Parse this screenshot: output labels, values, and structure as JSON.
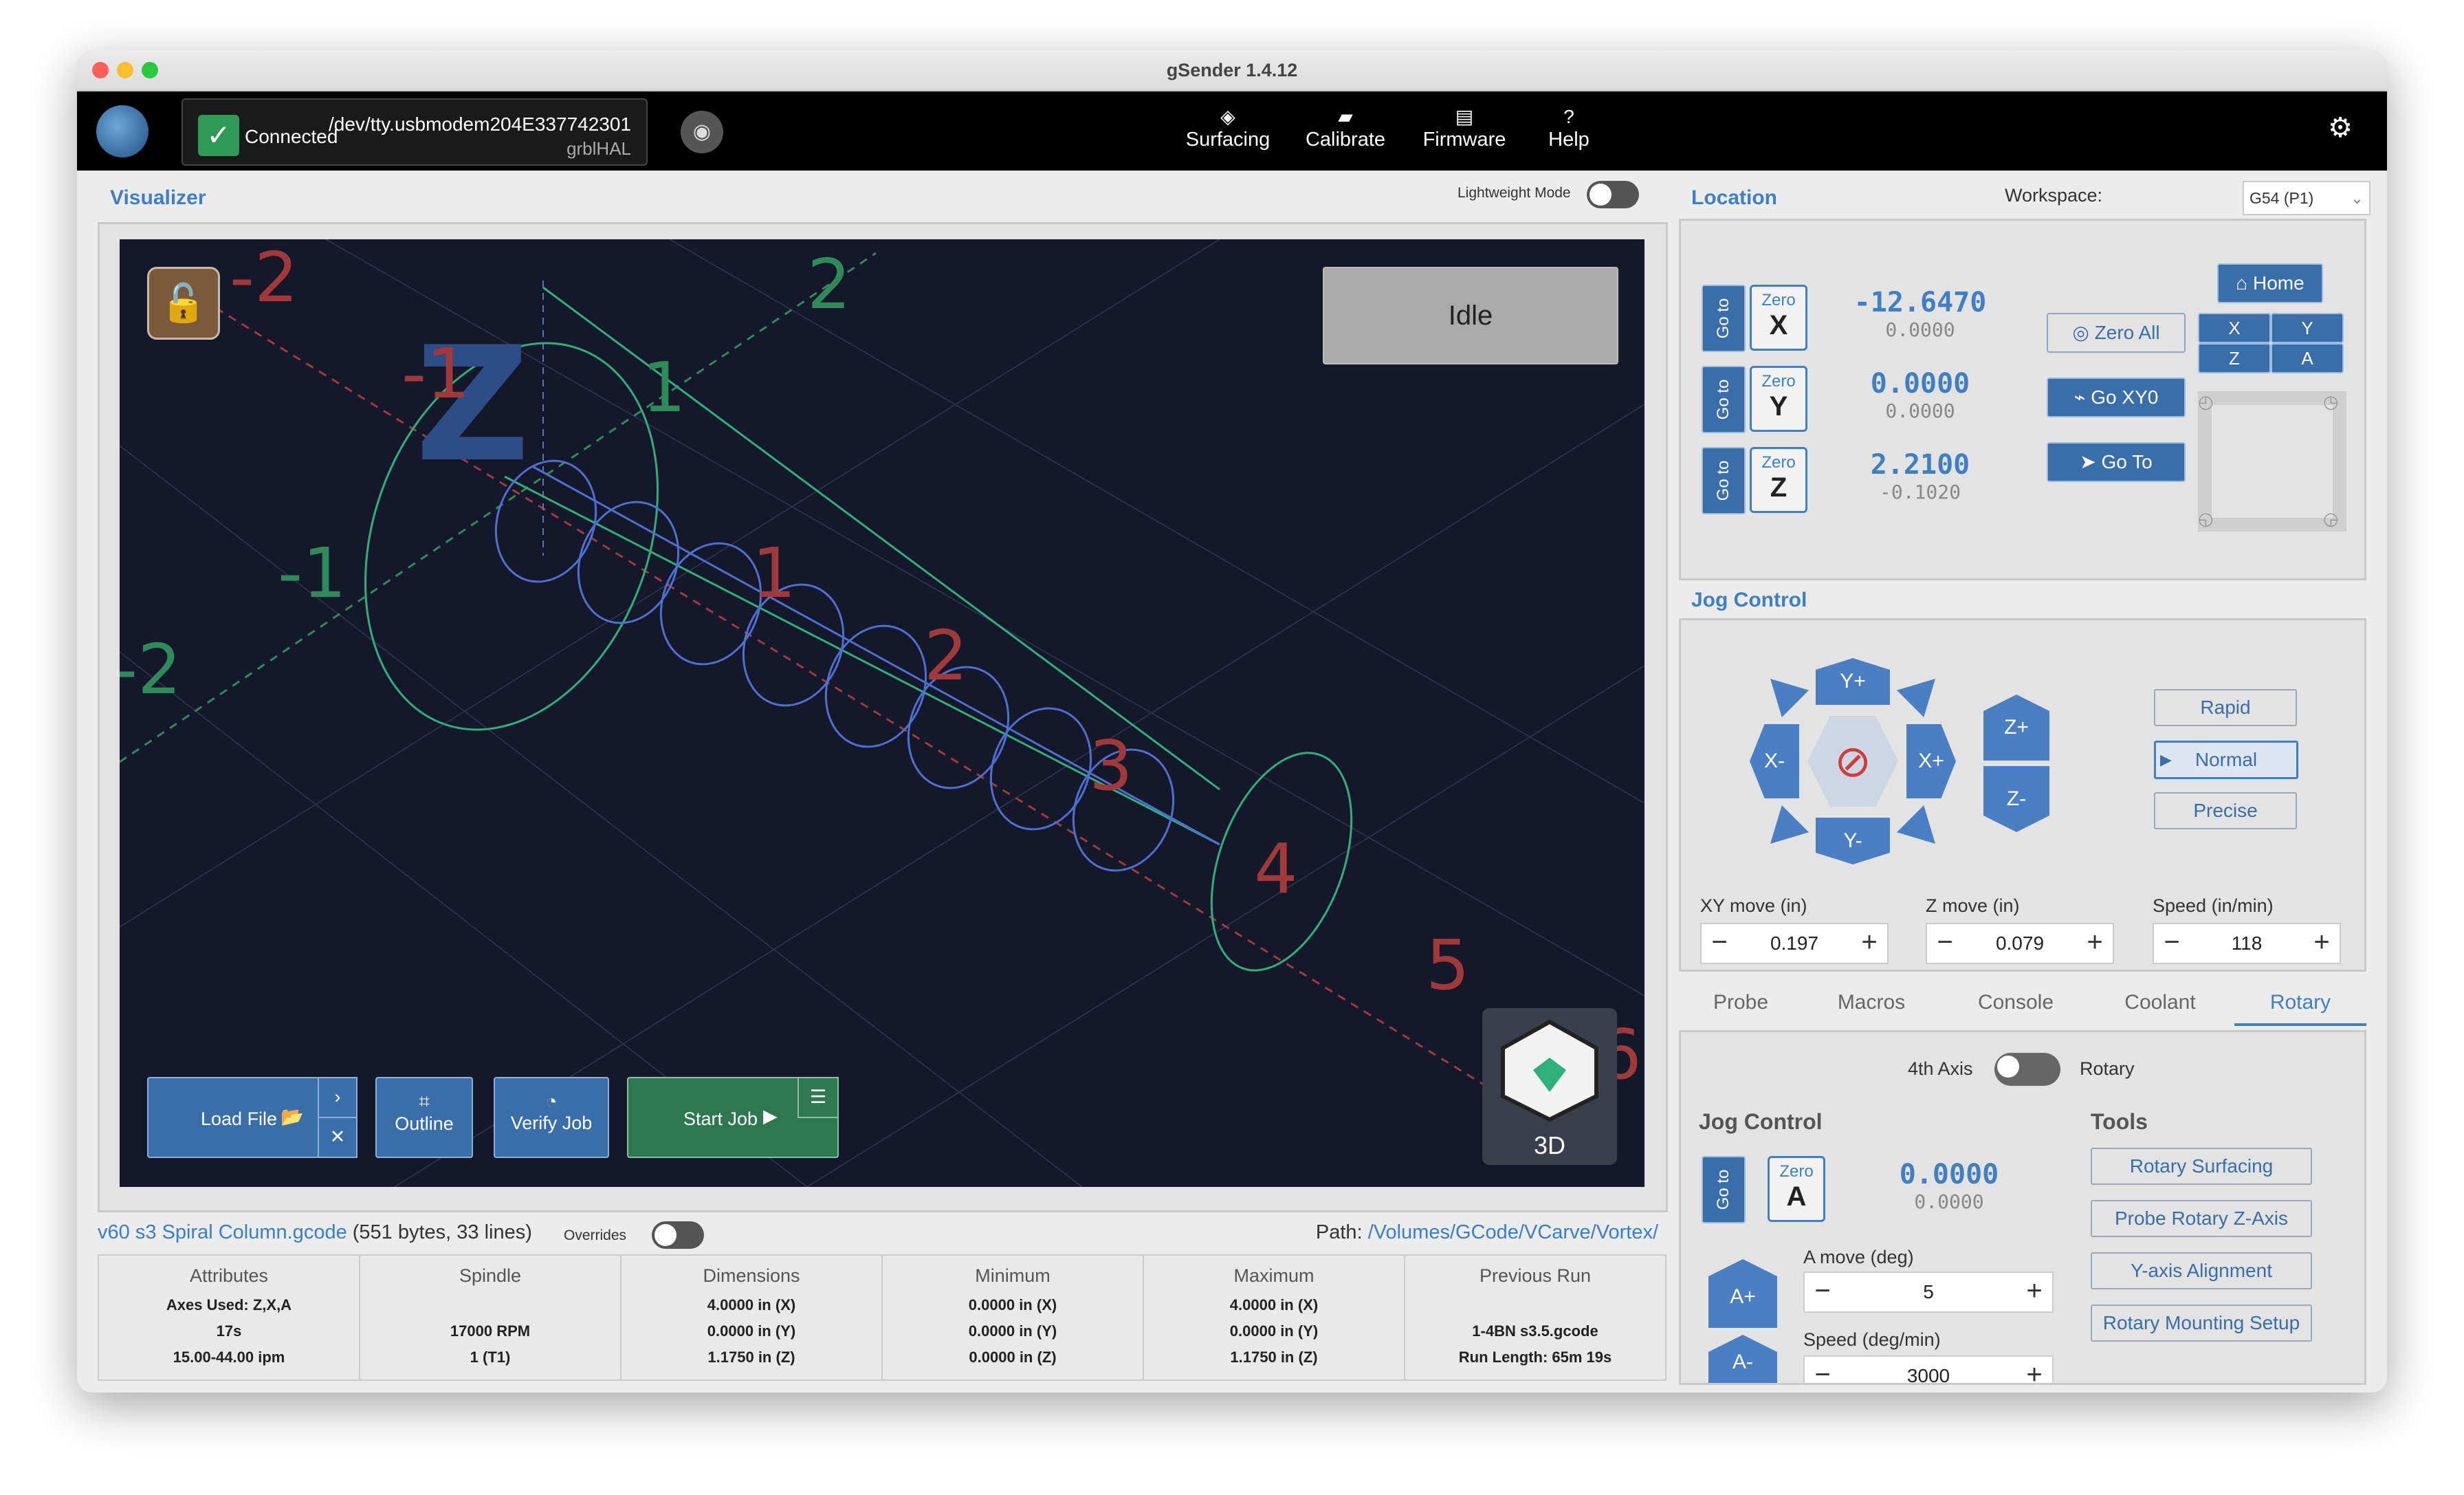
{
  "window": {
    "title": "gSender 1.4.12"
  },
  "topbar": {
    "connection": {
      "status": "Connected",
      "port": "/dev/tty.usbmodem204E337742301",
      "firmware": "grblHAL"
    },
    "nav": [
      {
        "label": "Surfacing",
        "icon": "surfacing-icon"
      },
      {
        "label": "Calibrate",
        "icon": "ruler-icon"
      },
      {
        "label": "Firmware",
        "icon": "chip-icon"
      },
      {
        "label": "Help",
        "icon": "help-icon"
      }
    ]
  },
  "visualizer": {
    "title": "Visualizer",
    "lightweight_label": "Lightweight Mode",
    "state": "Idle",
    "view_label": "3D",
    "grid_labels": [
      "-2",
      "2",
      "-1",
      "1",
      "-1",
      "-2",
      "1",
      "2",
      "3",
      "4",
      "5",
      "6"
    ],
    "z_axis_label": "Z",
    "buttons": {
      "load_file": "Load File",
      "outline": "Outline",
      "verify_job": "Verify Job",
      "start_job": "Start Job"
    }
  },
  "file": {
    "name": "v60 s3 Spiral Column.gcode",
    "info": "(551 bytes, 33 lines)",
    "overrides_label": "Overrides",
    "path_label": "Path:",
    "path": "/Volumes/GCode/VCarve/Vortex/"
  },
  "stats": [
    {
      "header": "Attributes",
      "lines": [
        "Axes Used: Z,X,A",
        "17s",
        "15.00-44.00 ipm"
      ]
    },
    {
      "header": "Spindle",
      "lines": [
        "",
        "17000 RPM",
        "1 (T1)"
      ]
    },
    {
      "header": "Dimensions",
      "lines": [
        "4.0000 in (X)",
        "0.0000 in (Y)",
        "1.1750 in (Z)"
      ]
    },
    {
      "header": "Minimum",
      "lines": [
        "0.0000 in (X)",
        "0.0000 in (Y)",
        "0.0000 in (Z)"
      ]
    },
    {
      "header": "Maximum",
      "lines": [
        "4.0000 in (X)",
        "0.0000 in (Y)",
        "1.1750 in (Z)"
      ]
    },
    {
      "header": "Previous Run",
      "lines": [
        "",
        "1-4BN s3.5.gcode",
        "Run Length: 65m 19s"
      ]
    }
  ],
  "location": {
    "title": "Location",
    "workspace_label": "Workspace:",
    "workspace_value": "G54 (P1)",
    "goto_label": "Go to",
    "zero_label": "Zero",
    "axes": [
      {
        "axis": "X",
        "machine": "-12.6470",
        "work": "0.0000"
      },
      {
        "axis": "Y",
        "machine": "0.0000",
        "work": "0.0000"
      },
      {
        "axis": "Z",
        "machine": "2.2100",
        "work": "-0.1020"
      }
    ],
    "zero_all": "Zero All",
    "go_xy0": "Go XY0",
    "go_to": "Go  To",
    "home": "Home",
    "home_axes": [
      "X",
      "Y",
      "Z",
      "A"
    ]
  },
  "jog": {
    "title": "Jog Control",
    "buttons": {
      "y_plus": "Y+",
      "y_minus": "Y-",
      "x_plus": "X+",
      "x_minus": "X-",
      "z_plus": "Z+",
      "z_minus": "Z-"
    },
    "speeds": [
      "Rapid",
      "Normal",
      "Precise"
    ],
    "selected_speed": "Normal",
    "xy_label": "XY move (in)",
    "xy_value": "0.197",
    "z_label": "Z move (in)",
    "z_value": "0.079",
    "speed_label": "Speed (in/min)",
    "speed_value": "118"
  },
  "tabs": [
    "Probe",
    "Macros",
    "Console",
    "Coolant",
    "Rotary"
  ],
  "active_tab": "Rotary",
  "rotary": {
    "axis4_label": "4th Axis",
    "rotary_label": "Rotary",
    "jog_title": "Jog Control",
    "tools_title": "Tools",
    "goto_label": "Go to",
    "zero_label": "Zero",
    "axis": "A",
    "machine": "0.0000",
    "work": "0.0000",
    "a_plus": "A+",
    "a_minus": "A-",
    "a_move_label": "A move (deg)",
    "a_move_value": "5",
    "speed_label": "Speed (deg/min)",
    "speed_value": "3000",
    "tools": [
      "Rotary Surfacing",
      "Probe Rotary Z-Axis",
      "Y-axis Alignment",
      "Rotary Mounting Setup"
    ]
  },
  "colors": {
    "accent": "#3f7fc2",
    "connected": "#2f9a56",
    "start": "#2e7751",
    "canvas": "#15182a"
  }
}
